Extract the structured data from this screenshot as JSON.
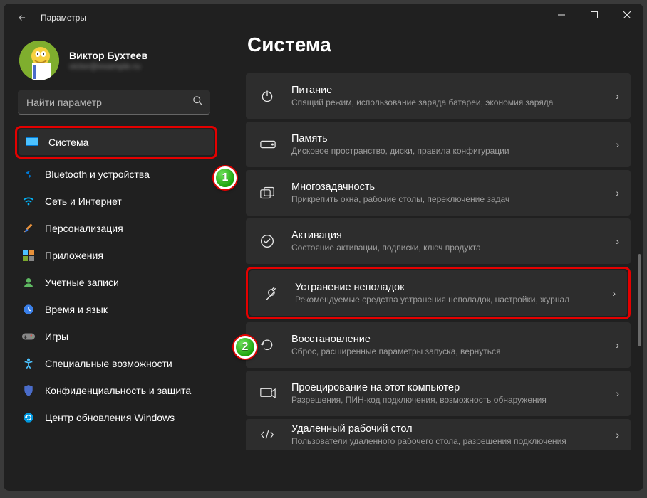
{
  "window": {
    "title": "Параметры"
  },
  "profile": {
    "name": "Виктор Бухтеев",
    "email": "victor@example.ru"
  },
  "search": {
    "placeholder": "Найти параметр"
  },
  "sidebar": {
    "items": [
      {
        "label": "Система"
      },
      {
        "label": "Bluetooth и устройства"
      },
      {
        "label": "Сеть и Интернет"
      },
      {
        "label": "Персонализация"
      },
      {
        "label": "Приложения"
      },
      {
        "label": "Учетные записи"
      },
      {
        "label": "Время и язык"
      },
      {
        "label": "Игры"
      },
      {
        "label": "Специальные возможности"
      },
      {
        "label": "Конфиденциальность и защита"
      },
      {
        "label": "Центр обновления Windows"
      }
    ]
  },
  "main": {
    "heading": "Система",
    "cards": [
      {
        "title": "Питание",
        "sub": "Спящий режим, использование заряда батареи, экономия заряда"
      },
      {
        "title": "Память",
        "sub": "Дисковое пространство, диски, правила конфигурации"
      },
      {
        "title": "Многозадачность",
        "sub": "Прикрепить окна, рабочие столы, переключение задач"
      },
      {
        "title": "Активация",
        "sub": "Состояние активации, подписки, ключ продукта"
      },
      {
        "title": "Устранение неполадок",
        "sub": "Рекомендуемые средства устранения неполадок, настройки, журнал"
      },
      {
        "title": "Восстановление",
        "sub": "Сброс, расширенные параметры запуска, вернуться"
      },
      {
        "title": "Проецирование на этот компьютер",
        "sub": "Разрешения, ПИН-код подключения, возможность обнаружения"
      },
      {
        "title": "Удаленный рабочий стол",
        "sub": "Пользователи удаленного рабочего стола, разрешения подключения"
      }
    ]
  },
  "annotations": {
    "one": "1",
    "two": "2"
  }
}
